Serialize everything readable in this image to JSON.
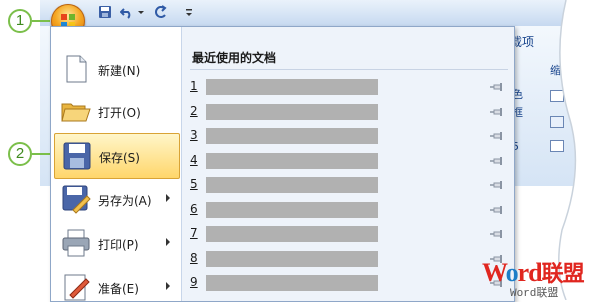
{
  "callouts": {
    "step1": "1",
    "step2": "2"
  },
  "ribbon": {
    "tab_label": "载项",
    "group_text_1": "色",
    "group_text_2": "框",
    "group_text_3": "5",
    "group_text_4": "缩"
  },
  "menu": {
    "items": [
      {
        "label": "新建(N)",
        "icon": "new-document-icon",
        "submenu": false
      },
      {
        "label": "打开(O)",
        "icon": "open-folder-icon",
        "submenu": false
      },
      {
        "label": "保存(S)",
        "icon": "save-disk-icon",
        "submenu": false,
        "selected": true
      },
      {
        "label": "另存为(A)",
        "icon": "save-as-icon",
        "submenu": true
      },
      {
        "label": "打印(P)",
        "icon": "printer-icon",
        "submenu": true
      },
      {
        "label": "准备(E)",
        "icon": "prepare-icon",
        "submenu": true
      }
    ],
    "recent": {
      "title": "最近使用的文档",
      "items": [
        "1",
        "2",
        "3",
        "4",
        "5",
        "6",
        "7",
        "8",
        "9"
      ]
    }
  },
  "watermark": {
    "brand_w": "W",
    "brand_o": "o",
    "brand_rd": "rd",
    "brand_cn": "联盟",
    "sub": "Word联盟"
  },
  "colors": {
    "highlight": "#ffd66b",
    "callout": "#7bbf4a",
    "recent_bar": "#b1b1b1"
  }
}
